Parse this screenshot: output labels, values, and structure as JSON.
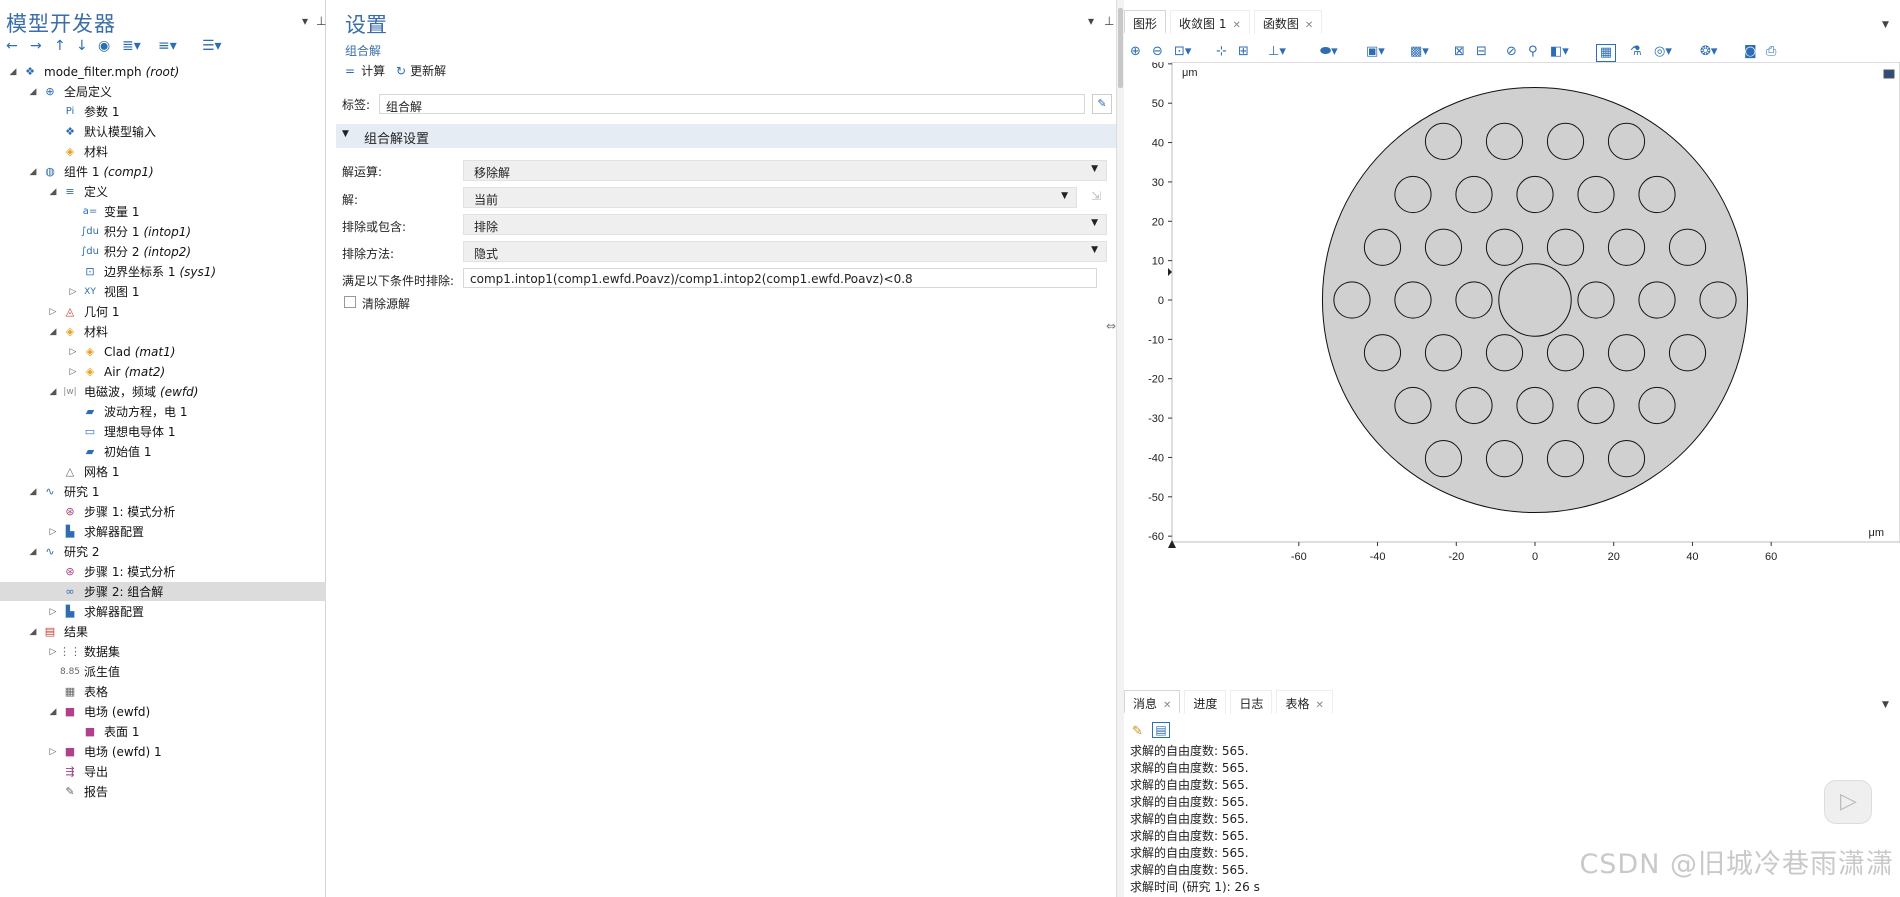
{
  "left": {
    "title": "模型开发器",
    "tree": [
      {
        "label": "mode_filter.mph",
        "suffix": "(root)"
      },
      {
        "label": "全局定义"
      },
      {
        "label": "参数 1"
      },
      {
        "label": "默认模型输入"
      },
      {
        "label": "材料"
      },
      {
        "label": "组件 1",
        "suffix": "(comp1)"
      },
      {
        "label": "定义"
      },
      {
        "label": "变量 1"
      },
      {
        "label": "积分 1",
        "suffix": "(intop1)"
      },
      {
        "label": "积分 2",
        "suffix": "(intop2)"
      },
      {
        "label": "边界坐标系 1",
        "suffix": "(sys1)"
      },
      {
        "label": "视图 1"
      },
      {
        "label": "几何 1"
      },
      {
        "label": "材料"
      },
      {
        "label": "Clad",
        "suffix": "(mat1)"
      },
      {
        "label": "Air",
        "suffix": "(mat2)"
      },
      {
        "label": "电磁波，频域",
        "suffix": "(ewfd)"
      },
      {
        "label": "波动方程，电 1"
      },
      {
        "label": "理想电导体 1"
      },
      {
        "label": "初始值 1"
      },
      {
        "label": "网格 1"
      },
      {
        "label": "研究 1"
      },
      {
        "label": "步骤 1: 模式分析"
      },
      {
        "label": "求解器配置"
      },
      {
        "label": "研究 2"
      },
      {
        "label": "步骤 1: 模式分析"
      },
      {
        "label": "步骤 2: 组合解"
      },
      {
        "label": "求解器配置"
      },
      {
        "label": "结果"
      },
      {
        "label": "数据集"
      },
      {
        "label": "派生值"
      },
      {
        "label": "表格"
      },
      {
        "label": "电场 (ewfd)"
      },
      {
        "label": "表面 1"
      },
      {
        "label": "电场 (ewfd) 1"
      },
      {
        "label": "导出"
      },
      {
        "label": "报告"
      }
    ]
  },
  "settings": {
    "title": "设置",
    "subtitle": "组合解",
    "compute": "计算",
    "update": "更新解",
    "label_caption": "标签:",
    "label_value": "组合解",
    "section": "组合解设置",
    "op_caption": "解运算:",
    "op_value": "移除解",
    "sol_caption": "解:",
    "sol_value": "当前",
    "exinc_caption": "排除或包含:",
    "exinc_value": "排除",
    "method_caption": "排除方法:",
    "method_value": "隐式",
    "cond_caption": "满足以下条件时排除:",
    "cond_value": "comp1.intop1(comp1.ewfd.Poavz)/comp1.intop2(comp1.ewfd.Poavz)<0.8",
    "clear_caption": "清除源解"
  },
  "graphics": {
    "tabs": [
      "图形",
      "收敛图 1",
      "函数图"
    ],
    "unit": "μm",
    "x_ticks": [
      "-60",
      "-40",
      "-20",
      "0",
      "20",
      "40",
      "60"
    ],
    "y_ticks": [
      "60",
      "50",
      "40",
      "30",
      "20",
      "10",
      "0",
      "-10",
      "-20",
      "-30",
      "-40",
      "-50",
      "-60"
    ]
  },
  "messages": {
    "tabs": [
      "消息",
      "进度",
      "日志",
      "表格"
    ],
    "lines": [
      "求解的自由度数: 565.",
      "求解的自由度数: 565.",
      "求解的自由度数: 565.",
      "求解的自由度数: 565.",
      "求解的自由度数: 565.",
      "求解的自由度数: 565.",
      "求解的自由度数: 565.",
      "求解的自由度数: 565.",
      "求解时间 (研究 1): 26 s"
    ]
  },
  "watermark": "CSDN @旧城冷巷雨潇潇"
}
